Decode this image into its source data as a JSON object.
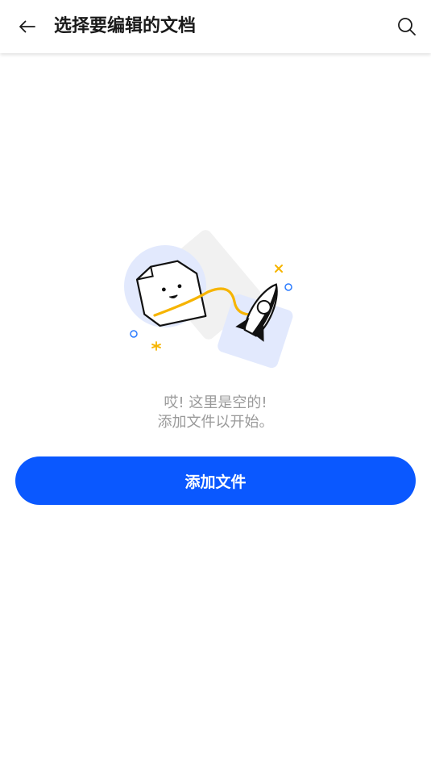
{
  "header": {
    "back_icon": "arrow-left-icon",
    "title": "选择要编辑的文档",
    "search_icon": "search-icon"
  },
  "empty_state": {
    "illustration": "empty-document-rocket-illustration",
    "line1": "哎! 这里是空的!",
    "line2": "添加文件以开始。"
  },
  "actions": {
    "add_file_label": "添加文件"
  },
  "colors": {
    "accent": "#0a58ff",
    "muted_text": "#9a9a9a",
    "yellow": "#f6b400"
  }
}
